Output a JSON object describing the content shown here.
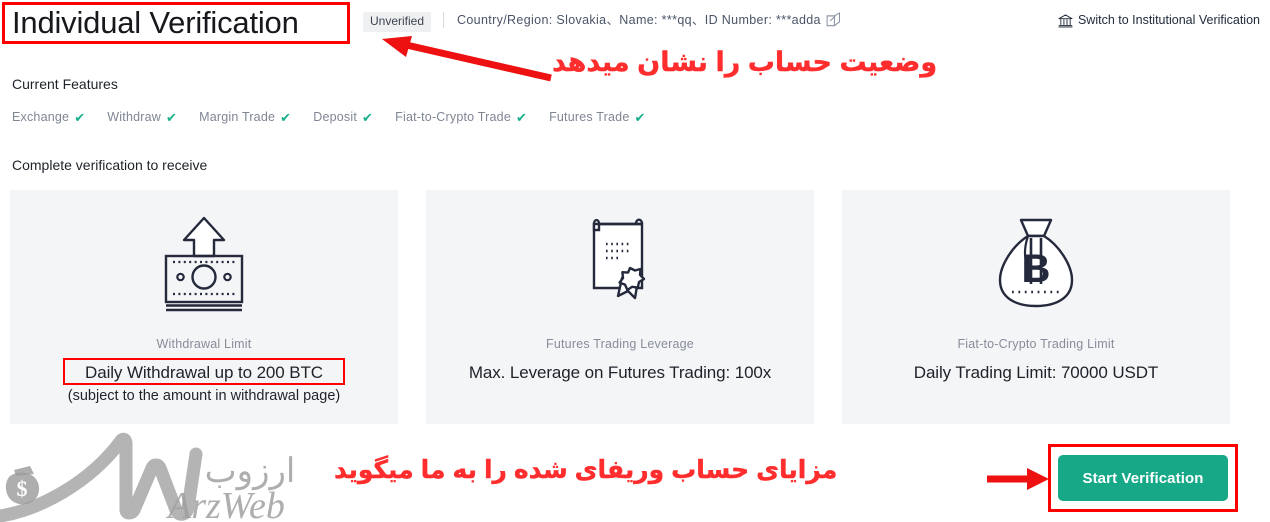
{
  "header": {
    "title": "Individual Verification",
    "status_badge": "Unverified",
    "account_info": "Country/Region: Slovakia、Name: ***qq、ID Number: ***adda",
    "edit_icon": "edit-square-icon",
    "switch_link": "Switch to Institutional Verification",
    "switch_icon": "bank-institution-icon"
  },
  "features": {
    "heading": "Current Features",
    "items": [
      {
        "label": "Exchange",
        "check": "✔"
      },
      {
        "label": "Withdraw",
        "check": "✔"
      },
      {
        "label": "Margin Trade",
        "check": "✔"
      },
      {
        "label": "Deposit",
        "check": "✔"
      },
      {
        "label": "Fiat-to-Crypto Trade",
        "check": "✔"
      },
      {
        "label": "Futures Trade",
        "check": "✔"
      }
    ]
  },
  "benefits": {
    "heading": "Complete verification to receive",
    "cards": [
      {
        "icon": "banknote-upload-icon",
        "label": "Withdrawal Limit",
        "value": "Daily Withdrawal up to 200 BTC",
        "note": "(subject to the amount in withdrawal page)",
        "highlighted": true
      },
      {
        "icon": "certificate-award-icon",
        "label": "Futures Trading Leverage",
        "value": "Max. Leverage on Futures Trading: 100x",
        "note": "",
        "highlighted": false
      },
      {
        "icon": "money-bag-bitcoin-icon",
        "label": "Fiat-to-Crypto Trading Limit",
        "value": "Daily Trading Limit: 70000 USDT",
        "note": "",
        "highlighted": false
      }
    ]
  },
  "action": {
    "start_button": "Start Verification",
    "button_color": "#17a888"
  },
  "annotations": {
    "color": "#ff2d2d",
    "items": [
      {
        "text": "وضعیت حساب را نشان میدهد",
        "name": "annotation-account-status"
      },
      {
        "text": "مزایای حساب وریفای شده را به ما میگوید",
        "name": "annotation-verified-benefits"
      }
    ],
    "arrows": [
      {
        "name": "arrow-to-status-badge",
        "direction": "left"
      },
      {
        "name": "arrow-to-start-button",
        "direction": "right"
      }
    ],
    "boxes": [
      {
        "name": "redbox-page-title"
      },
      {
        "name": "redbox-withdrawal-value"
      },
      {
        "name": "redbox-start-button"
      }
    ]
  },
  "watermark": {
    "brand_latin": "ArzWeb",
    "brand_persian": "ارزوب",
    "monogram": "W",
    "icon": "money-bag-dollar-icon",
    "color": "#9a9a9a"
  }
}
